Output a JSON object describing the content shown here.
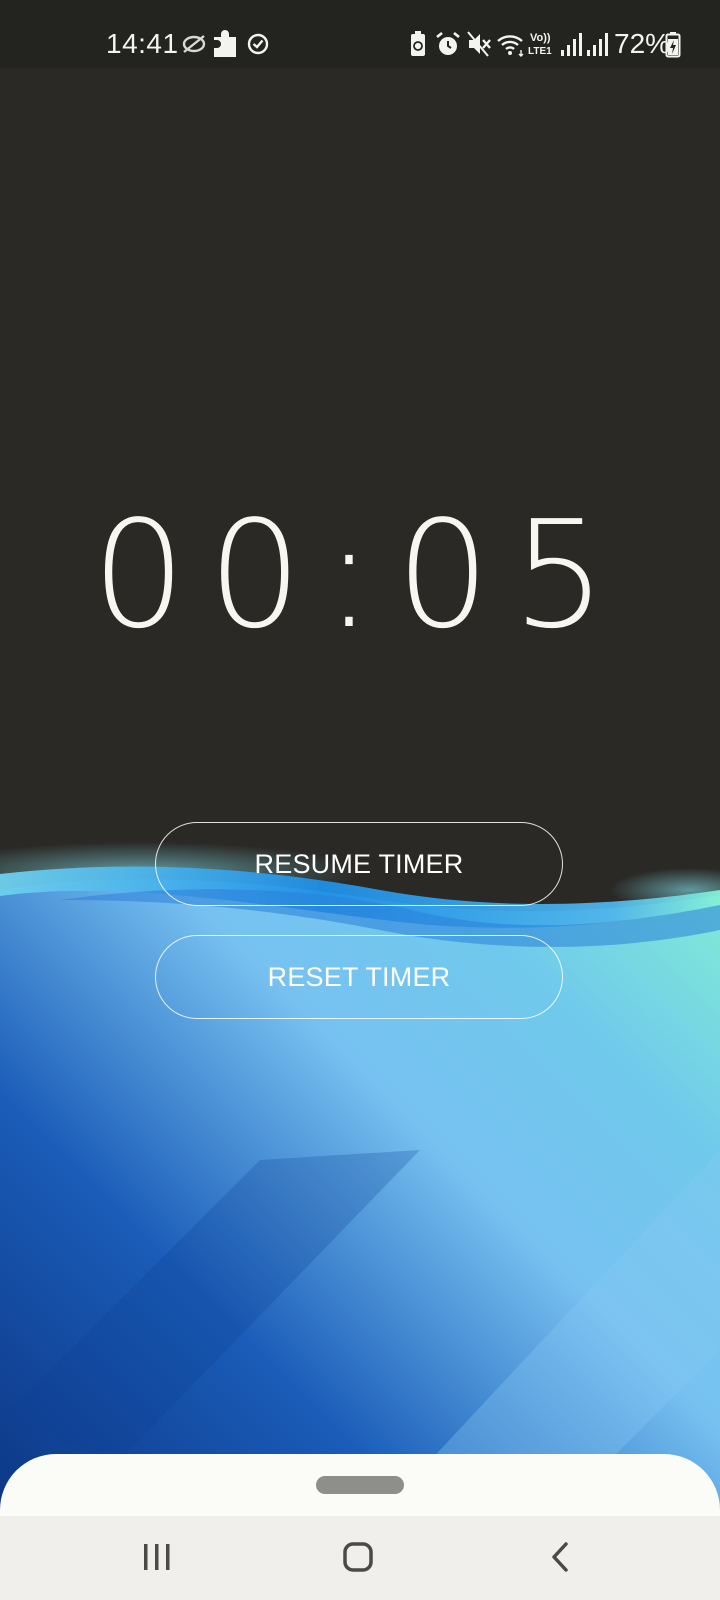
{
  "status_bar": {
    "time": "14:41",
    "battery_percent": "72%",
    "network_label": "Vo))\nLTE1",
    "left_icons": [
      "do-not-disturb-icon",
      "puzzle-icon",
      "clock-check-icon"
    ],
    "right_icons": [
      "battery-saver-icon",
      "alarm-icon",
      "mute-icon",
      "wifi-icon",
      "volte-icon",
      "signal-icon",
      "signal-icon",
      "battery-icon"
    ]
  },
  "timer": {
    "display": "00:05"
  },
  "buttons": {
    "resume_label": "RESUME TIMER",
    "reset_label": "RESET TIMER"
  },
  "navigation": {
    "icons": [
      "recent-apps-icon",
      "home-icon",
      "back-icon"
    ]
  },
  "colors": {
    "background": "#2a2926",
    "wave_light_blue": "#76c2f2",
    "wave_deep_blue": "#1150a8",
    "wave_teal": "#7de8d2",
    "text": "#f7f6f1"
  }
}
